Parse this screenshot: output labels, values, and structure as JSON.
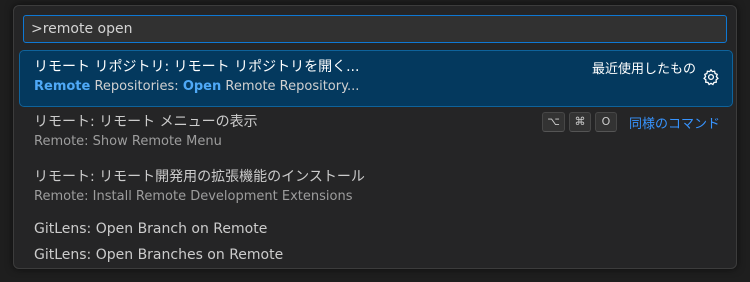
{
  "search": {
    "value": ">remote open"
  },
  "results": [
    {
      "primary": "リモート リポジトリ: リモート リポジトリを開く...",
      "secondary_parts": [
        "Remote",
        " Repositories: ",
        "Open",
        " Remote Repository..."
      ],
      "recent_label": "最近使用したもの",
      "icon": "gear-icon"
    },
    {
      "primary": "リモート: リモート メニューの表示",
      "secondary": "Remote: Show Remote Menu",
      "keys": [
        "⌥",
        "⌘",
        "O"
      ],
      "similar_label": "同様のコマンド"
    },
    {
      "primary": "リモート: リモート開発用の拡張機能のインストール",
      "secondary": "Remote: Install Remote Development Extensions"
    },
    {
      "primary": "GitLens: Open Branch on Remote"
    },
    {
      "primary": "GitLens: Open Branches on Remote"
    }
  ],
  "colors": {
    "accent": "#0e78d4",
    "selected_bg": "#04395e",
    "highlight": "#4fa9f7",
    "link": "#3794ff"
  }
}
